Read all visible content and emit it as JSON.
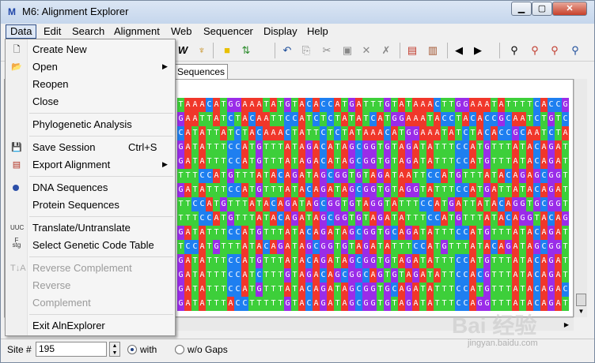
{
  "window": {
    "title": "M6: Alignment Explorer"
  },
  "titlebar_buttons": {
    "minimize": "▁",
    "maximize": "▢",
    "close": "✕"
  },
  "menubar": [
    "Data",
    "Edit",
    "Search",
    "Alignment",
    "Web",
    "Sequencer",
    "Display",
    "Help"
  ],
  "tab_label": "Sequences",
  "dropdown": {
    "create_new": "Create New",
    "open": "Open",
    "reopen": "Reopen",
    "close": "Close",
    "phylo": "Phylogenetic Analysis",
    "save_session": "Save Session",
    "save_shortcut": "Ctrl+S",
    "export": "Export Alignment",
    "dna": "DNA Sequences",
    "protein": "Protein Sequences",
    "translate": "Translate/Untranslate",
    "select_code": "Select Genetic Code Table",
    "reverse_complement": "Reverse Complement",
    "reverse": "Reverse",
    "complement": "Complement",
    "exit": "Exit AlnExplorer"
  },
  "status": {
    "site_label": "Site #",
    "site_value": "195",
    "with_label": "with",
    "without_label": "w/o Gaps"
  },
  "sequences": [
    "TAAACATGGAAATATGTACACCATGATTTGTATAAACTTGGAAATATTTTCACCG",
    "GAATTATCTACAATTCCATCTCTATATCATGGAAATACCTACACCGCAATCTGTC",
    "CATATTATCTACAAACTATTCTCTATAAACATGGAAATATCTACACCGCAATCTA",
    "GATATTTCCATGTTTATAGACATAGCGGTGTAGATATTTCCATGTTTATACAGAT",
    "GATATTTCCATGTTTATAGACATAGCGGTGTAGATATTTCCATGTTTATACAGAT",
    "TTTCCATGTTTATACAGATAGCGGTGTAGATAATTCCATGTTTATACAGAGCGGT",
    "GATATTTCCATGTTTATACAGATAGCGGTGTAGGTATTTCCATGATTATACAGAT",
    "TTCCATGTTTATACAGATAGCGGTGTAGGTATTTCCATGATTATACAGGTGCGGT",
    "TTTCCATGTTTATACAGATAGCGGTGTAGATATTTCCATGTTTATACAGGTACAG",
    "GATATTTCCATGTTTATACAGATAGCGGTGCAGATATTTCCATGTTTATACAGAT",
    "TCCATGTTTATACAGATAGCGGTGTAGATATTTCCATGTTTATACAGATAGCGGT",
    "GATATTTCCATGTTTATACAGATAGCGGTGTAGATATTTCCATGTTTATACAGAT",
    "GATATTTCCATCTTTGTAGACAGCGGCAGTGTAGATATTCCACGTTTATACAGAT",
    "GATATTTCCATGTTTATACAGATAGCGGTGCAGATATTTCCATGTTTATACAGAC",
    "GATATTTACCTTTTTGTACAGATAGCGGTGTAGATATTTCCAGGTTTATACAGAT"
  ],
  "watermark": {
    "main": "Bai 经验",
    "sub": "jingyan.baidu.com"
  }
}
